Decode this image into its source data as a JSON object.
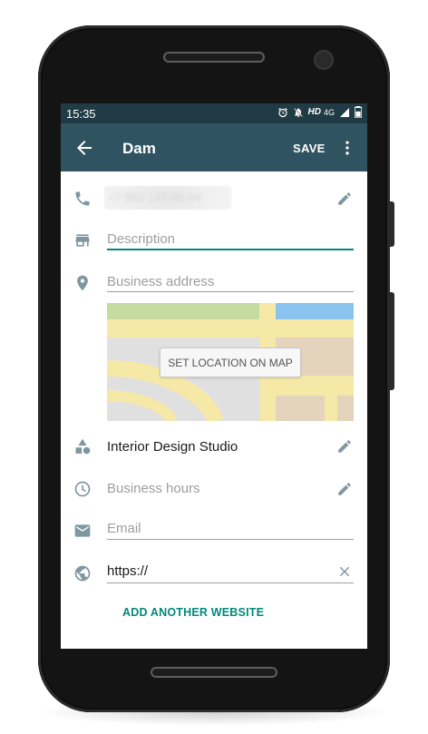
{
  "status_bar": {
    "time": "15:35",
    "network_label": "HD",
    "signal_label": "4G"
  },
  "app_bar": {
    "title": "Dam",
    "save_label": "SAVE"
  },
  "form": {
    "phone_value_obscured": "+7 903 147-00-04",
    "description_placeholder": "Description",
    "address_placeholder": "Business address",
    "map_button_label": "SET LOCATION ON MAP",
    "category_value": "Interior Design Studio",
    "hours_placeholder": "Business hours",
    "email_placeholder": "Email",
    "website_value": "https://",
    "add_website_label": "ADD ANOTHER WEBSITE"
  },
  "colors": {
    "status_bar": "#203b45",
    "app_bar": "#2f5360",
    "accent": "#00897b",
    "icon": "#7f97a0",
    "placeholder": "#9e9e9e"
  },
  "icons": {
    "back": "arrow-back-icon",
    "menu": "more-vert-icon",
    "phone": "phone-icon",
    "store": "store-icon",
    "location": "location-pin-icon",
    "category": "category-shapes-icon",
    "clock": "clock-icon",
    "email": "email-icon",
    "web": "globe-icon",
    "edit": "pencil-icon",
    "clear": "close-icon"
  }
}
